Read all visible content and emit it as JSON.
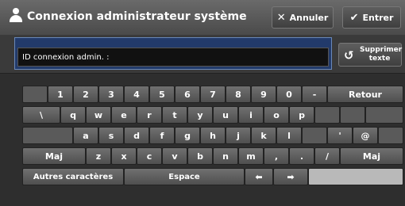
{
  "header": {
    "title": "Connexion administrateur système",
    "cancel_label": "Annuler",
    "enter_label": "Entrer"
  },
  "input": {
    "field_label": "ID connexion admin. :",
    "delete_label": "Supprimer texte"
  },
  "keyboard": {
    "row1": [
      "1",
      "2",
      "3",
      "4",
      "5",
      "6",
      "7",
      "8",
      "9",
      "0",
      "-"
    ],
    "return_label": "Retour",
    "row2": [
      "\\",
      "q",
      "w",
      "e",
      "r",
      "t",
      "y",
      "u",
      "i",
      "o",
      "p"
    ],
    "row3": [
      "a",
      "s",
      "d",
      "f",
      "g",
      "h",
      "j",
      "k",
      "l",
      "'",
      "@"
    ],
    "row4": [
      "z",
      "x",
      "c",
      "v",
      "b",
      "n",
      "m",
      ",",
      ".",
      "/"
    ],
    "shift_label": "Maj",
    "other_chars_label": "Autres caractères",
    "space_label": "Espace",
    "arrow_left": "⬅",
    "arrow_right": "➡"
  }
}
